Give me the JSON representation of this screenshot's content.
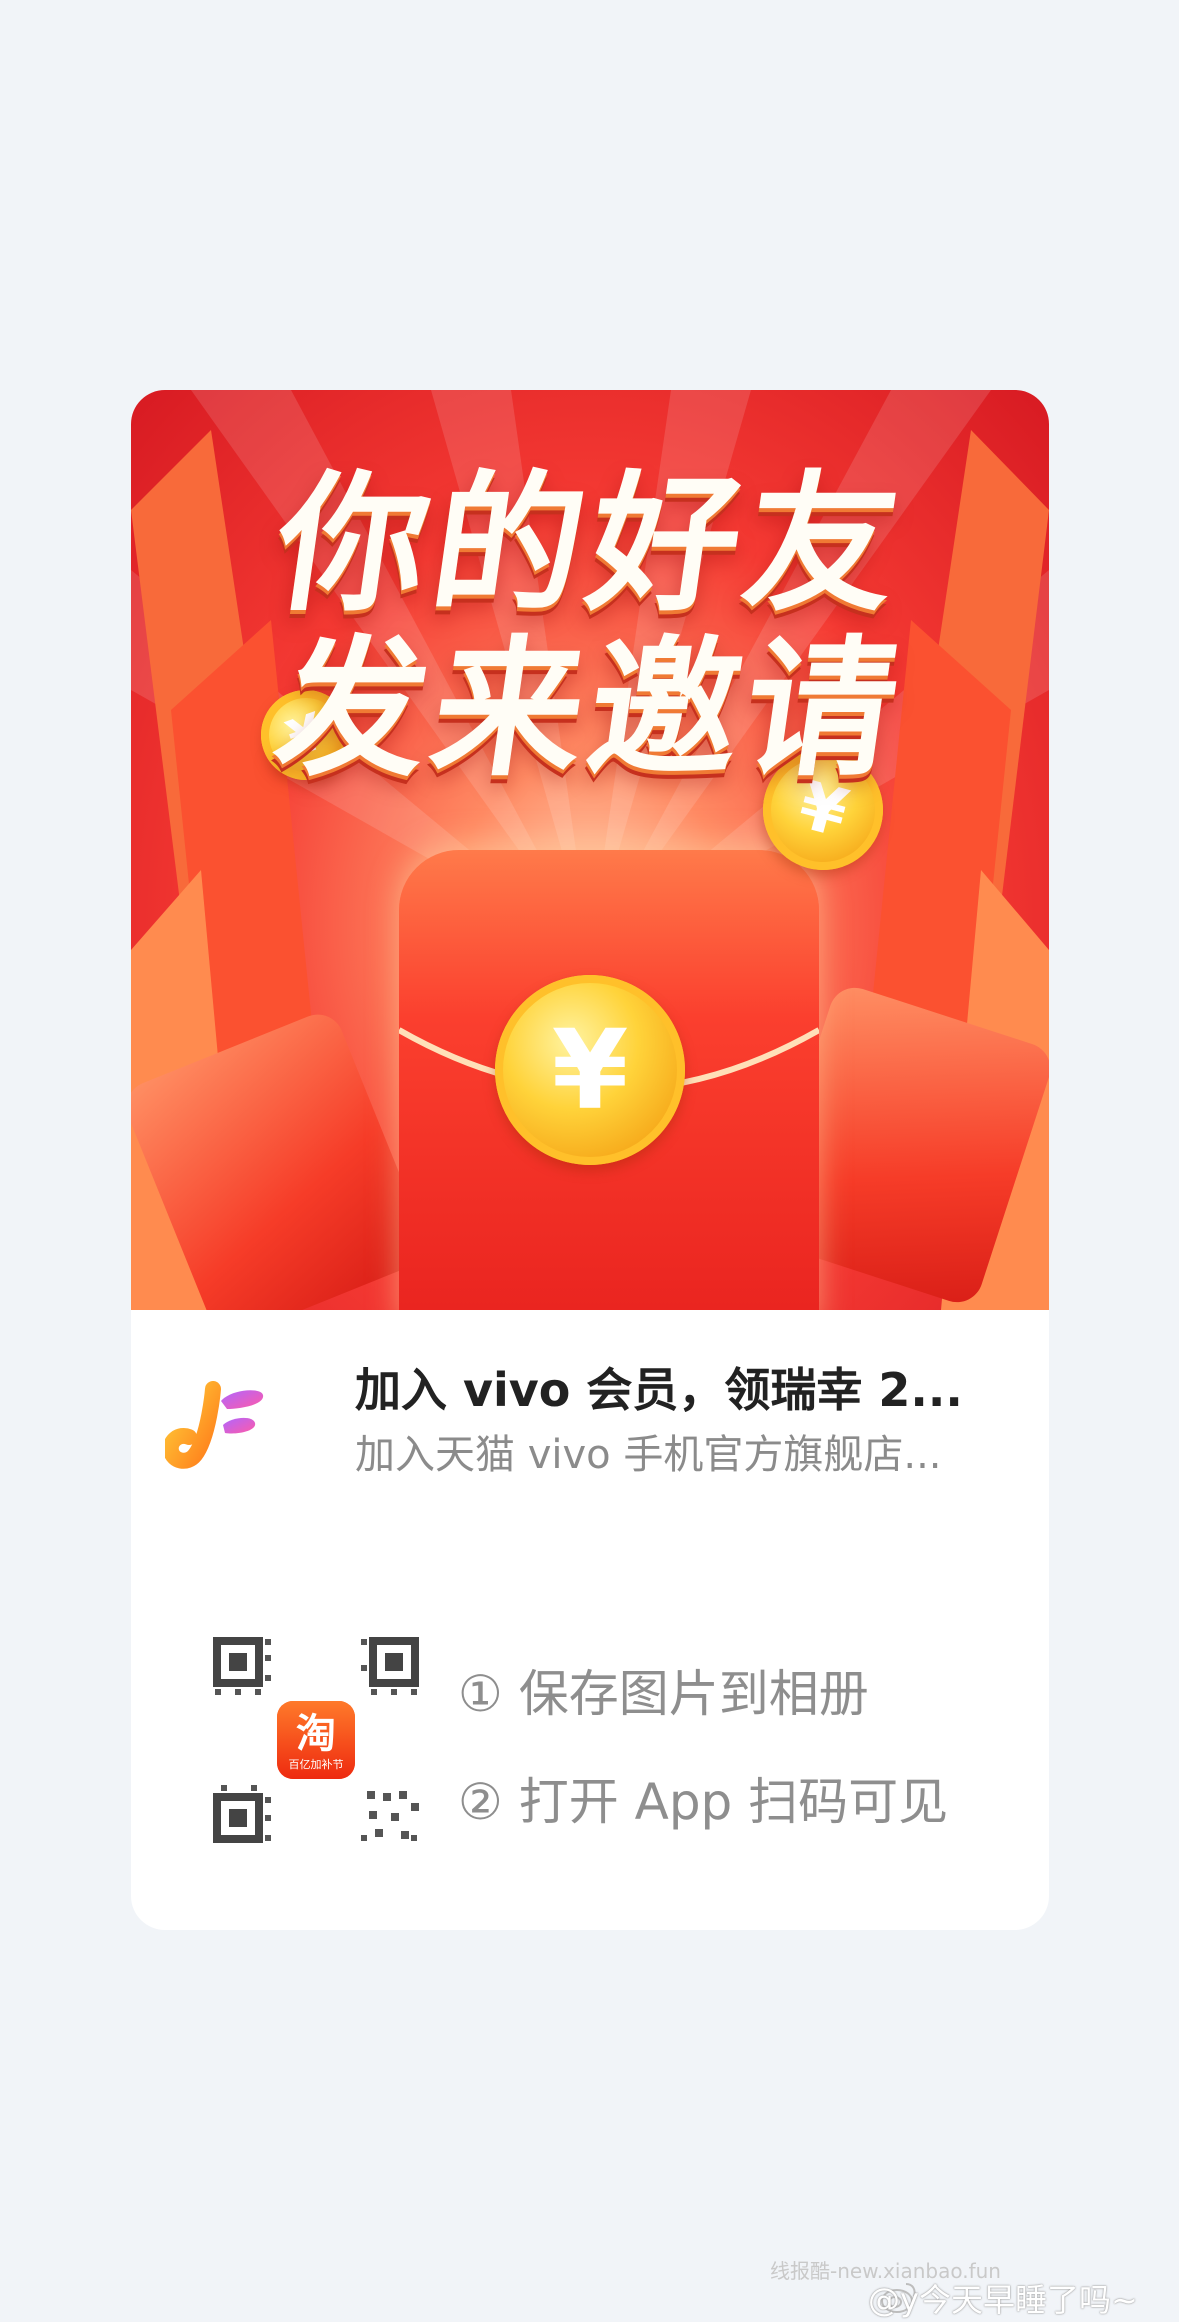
{
  "banner": {
    "headline_line1": "你的好友",
    "headline_line2": "发来邀请",
    "coin_symbol": "¥"
  },
  "info": {
    "title": "加入 vivo 会员，领瑞幸 2...",
    "subtitle": "加入天猫 vivo 手机官方旗舰店..."
  },
  "qr": {
    "center_badge_char": "淘",
    "center_badge_caption": "百亿加补节"
  },
  "steps": [
    "① 保存图片到相册",
    "② 打开 App 扫码可见"
  ],
  "watermark": {
    "site": "线报酷-new.xianbao.fun",
    "user": "@y今天早睡了吗~"
  },
  "colors": {
    "page_bg": "#f1f4f8",
    "banner_red": "#f53a33",
    "gold": "#ffd33a",
    "step_text": "#8e8e8e"
  }
}
